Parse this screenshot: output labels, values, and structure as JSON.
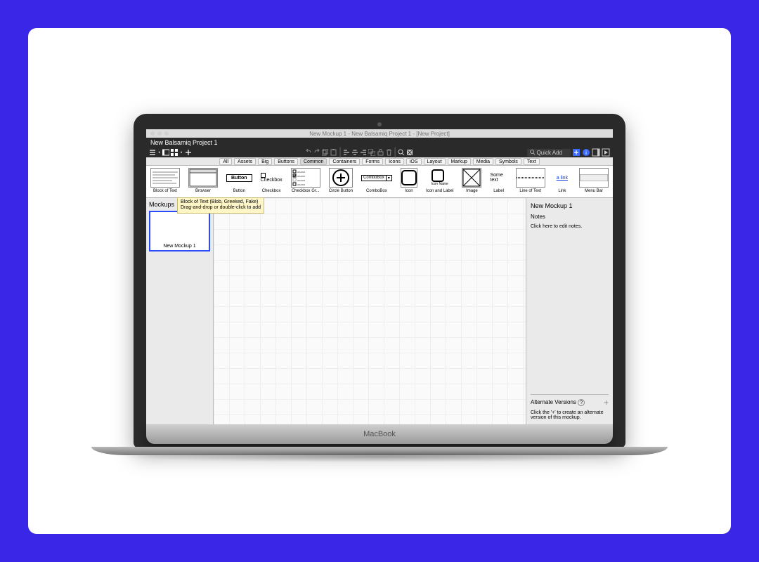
{
  "window": {
    "mac_title": "New Mockup 1 - New Balsamiq Project 1 - [New Project]",
    "project_title": "New Balsamiq Project 1",
    "quick_add_placeholder": "Quick Add",
    "macbook_label": "MacBook"
  },
  "categories": [
    "All",
    "Assets",
    "Big",
    "Buttons",
    "Common",
    "Containers",
    "Forms",
    "Icons",
    "iOS",
    "Layout",
    "Markup",
    "Media",
    "Symbols",
    "Text"
  ],
  "selected_category": "Common",
  "library": [
    {
      "label": "Block of Text",
      "thumb": "blocktext"
    },
    {
      "label": "Browser",
      "thumb": "browser"
    },
    {
      "label": "Button",
      "thumb": "button",
      "text": "Button"
    },
    {
      "label": "Checkbox",
      "thumb": "checkbox",
      "text": "Checkbox"
    },
    {
      "label": "Checkbox Gr...",
      "thumb": "checkboxgrp"
    },
    {
      "label": "Circle Button",
      "thumb": "circleplus"
    },
    {
      "label": "ComboBox",
      "thumb": "combobox",
      "text": "ComboBox"
    },
    {
      "label": "Icon",
      "thumb": "iconsquare"
    },
    {
      "label": "Icon and Label",
      "thumb": "iconlabel",
      "text": "Icon Name"
    },
    {
      "label": "Image",
      "thumb": "imgplaceholder"
    },
    {
      "label": "Label",
      "thumb": "labeltext",
      "text": "Some text"
    },
    {
      "label": "Line of Text",
      "thumb": "lineoftext"
    },
    {
      "label": "Link",
      "thumb": "link",
      "text": "a link"
    },
    {
      "label": "Menu Bar",
      "thumb": "menubar"
    }
  ],
  "sidebar": {
    "heading": "Mockups",
    "items": [
      "New Mockup 1"
    ]
  },
  "tooltip": {
    "line1": "Block of Text (Blob, Greeked, Fake)",
    "line2": "Drag-and-drop or double-click to add"
  },
  "inspector": {
    "mockup_name": "New Mockup 1",
    "notes_label": "Notes",
    "notes_placeholder": "Click here to edit notes.",
    "alt_heading": "Alternate Versions",
    "alt_help": "Click the '+' to create an alternate version of this mockup."
  }
}
